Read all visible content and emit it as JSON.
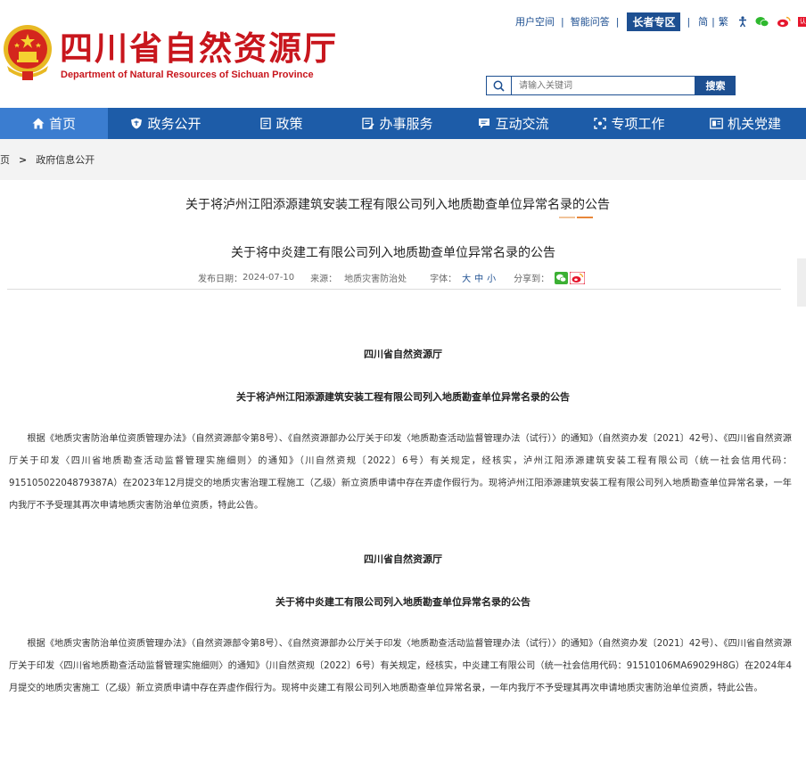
{
  "header": {
    "title": "四川省自然资源厅",
    "subtitle": "Department of Natural Resources of Sichuan Province",
    "toplinks": {
      "user_space": "用户空间",
      "qa": "智能问答",
      "elder": "长者专区",
      "simplified": "简",
      "traditional": "繁",
      "weibo_badge": "认证"
    },
    "search": {
      "placeholder": "请输入关键词",
      "button": "搜索"
    }
  },
  "nav": {
    "items": [
      {
        "label": "首页",
        "icon": "home-icon"
      },
      {
        "label": "政务公开",
        "icon": "shield-icon"
      },
      {
        "label": "政策",
        "icon": "document-icon"
      },
      {
        "label": "办事服务",
        "icon": "form-icon"
      },
      {
        "label": "互动交流",
        "icon": "chat-icon"
      },
      {
        "label": "专项工作",
        "icon": "focus-icon"
      },
      {
        "label": "机关党建",
        "icon": "party-icon"
      }
    ]
  },
  "breadcrumb": {
    "home": "首页",
    "separator": ">",
    "current": "政府信息公开"
  },
  "content": {
    "heading": "关于将泸州江阳添源建筑安装工程有限公司列入地质勘查单位异常名录的公告",
    "article_title": "关于将中炎建工有限公司列入地质勘查单位异常名录的公告",
    "meta": {
      "date_label": "发布日期：",
      "date": "2024-07-10",
      "source_label": "来源：",
      "source": "地质灾害防治处",
      "font_label": "字体：",
      "font_large": "大",
      "font_medium": "中",
      "font_small": "小",
      "share_label": "分享到："
    },
    "sections": [
      {
        "org": "四川省自然资源厅",
        "title": "关于将泸州江阳添源建筑安装工程有限公司列入地质勘查单位异常名录的公告",
        "body": "根据《地质灾害防治单位资质管理办法》（自然资源部令第8号）、《自然资源部办公厅关于印发〈地质勘查活动监督管理办法（试行）〉的通知》（自然资办发〔2021〕42号）、《四川省自然资源厅关于印发〈四川省地质勘查活动监督管理实施细则〉的通知》（川自然资规〔2022〕6号）有关规定，经核实，泸州江阳添源建筑安装工程有限公司（统一社会信用代码：91510502204879387A）在2023年12月提交的地质灾害治理工程施工（乙级）新立资质申请中存在弄虚作假行为。现将泸州江阳添源建筑安装工程有限公司列入地质勘查单位异常名录，一年内我厅不予受理其再次申请地质灾害防治单位资质，特此公告。"
      },
      {
        "org": "四川省自然资源厅",
        "title": "关于将中炎建工有限公司列入地质勘查单位异常名录的公告",
        "body": "根据《地质灾害防治单位资质管理办法》（自然资源部令第8号）、《自然资源部办公厅关于印发〈地质勘查活动监督管理办法（试行）〉的通知》（自然资办发〔2021〕42号）、《四川省自然资源厅关于印发〈四川省地质勘查活动监督管理实施细则〉的通知》（川自然资规〔2022〕6号）有关规定，经核实，中炎建工有限公司（统一社会信用代码：91510106MA69029H8G）在2024年4月提交的地质灾害施工（乙级）新立资质申请中存在弄虚作假行为。现将中炎建工有限公司列入地质勘查单位异常名录，一年内我厅不予受理其再次申请地质灾害防治单位资质，特此公告。"
      }
    ]
  },
  "colors": {
    "brand_red": "#c8161d",
    "nav_blue": "#1d5ca8",
    "nav_active": "#3b7dd0",
    "link_blue": "#1d4f91"
  }
}
